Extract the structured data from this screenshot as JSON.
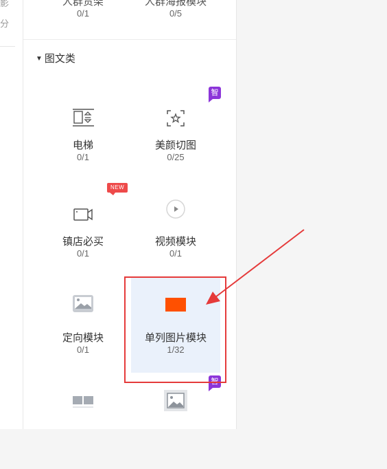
{
  "sidebar_strip": {
    "glyph_top": "影",
    "glyph_bottom": "分"
  },
  "top_row": [
    {
      "name": "人群货架",
      "count": "0/1"
    },
    {
      "name": "人群海报模块",
      "count": "0/5"
    }
  ],
  "section": {
    "title": "图文类",
    "items": [
      {
        "name": "电梯",
        "count": "0/1",
        "icon": "elevator-icon"
      },
      {
        "name": "美颜切图",
        "count": "0/25",
        "icon": "beauty-crop-icon",
        "badge": "智"
      },
      {
        "name": "镇店必买",
        "count": "0/1",
        "icon": "video-camera-icon",
        "badge": "NEW"
      },
      {
        "name": "视频模块",
        "count": "0/1",
        "icon": "play-circle-icon"
      },
      {
        "name": "定向模块",
        "count": "0/1",
        "icon": "image-icon"
      },
      {
        "name": "单列图片模块",
        "count": "1/32",
        "icon": "single-image-block-icon"
      },
      {
        "icon": "double-column-image-icon"
      },
      {
        "icon": "smart-image-icon",
        "badge": "智"
      }
    ]
  },
  "colors": {
    "accent_orange": "#ff5000",
    "badge_purple": "#8c35d9",
    "badge_red": "#ee4a4a",
    "annotation_red": "#e53a3a",
    "selected_bg": "#eaf1fb"
  }
}
